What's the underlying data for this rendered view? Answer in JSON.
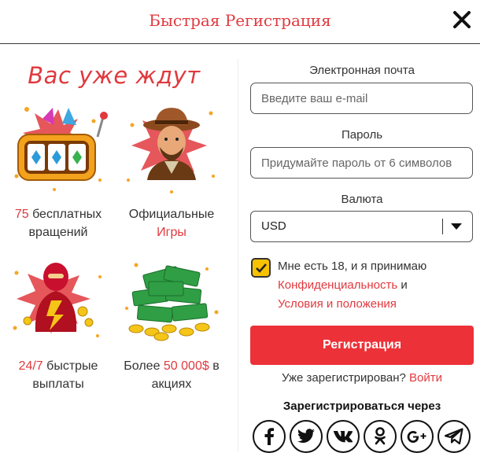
{
  "header": {
    "title": "Быстрая Регистрация",
    "close_icon": "close-icon"
  },
  "promo": {
    "title": "Вас уже ждут",
    "features": [
      {
        "icon": "slot-machine-icon",
        "highlight": "75",
        "text": " бесплатных вращений"
      },
      {
        "icon": "explorer-character-icon",
        "text": "Официальные ",
        "highlight": "Игры"
      },
      {
        "icon": "hero-character-icon",
        "highlight": "24/7",
        "text": " быстрые выплаты"
      },
      {
        "icon": "money-pile-icon",
        "text": "Более ",
        "highlight": "50 000$",
        "text2": " в акциях"
      }
    ]
  },
  "form": {
    "email": {
      "label": "Электронная почта",
      "placeholder": "Введите ваш e-mail"
    },
    "password": {
      "label": "Пароль",
      "placeholder": "Придумайте пароль от 6 символов"
    },
    "currency": {
      "label": "Валюта",
      "value": "USD"
    },
    "agreement": {
      "checked": true,
      "text": "Мне есть 18, и я принимаю",
      "privacy_link": "Конфиденциальность",
      "and": " и",
      "terms_link": "Условия и положения"
    },
    "submit_label": "Регистрация",
    "already_text": "Уже зарегистрирован? ",
    "login_link": "Войти",
    "social_title": "Зарегистрироваться через",
    "socials": [
      "facebook-icon",
      "twitter-icon",
      "vk-icon",
      "odnoklassniki-icon",
      "google-plus-icon",
      "telegram-icon"
    ]
  },
  "colors": {
    "accent": "#e0393e",
    "button": "#ec3238",
    "checkbox": "#f7c200"
  }
}
